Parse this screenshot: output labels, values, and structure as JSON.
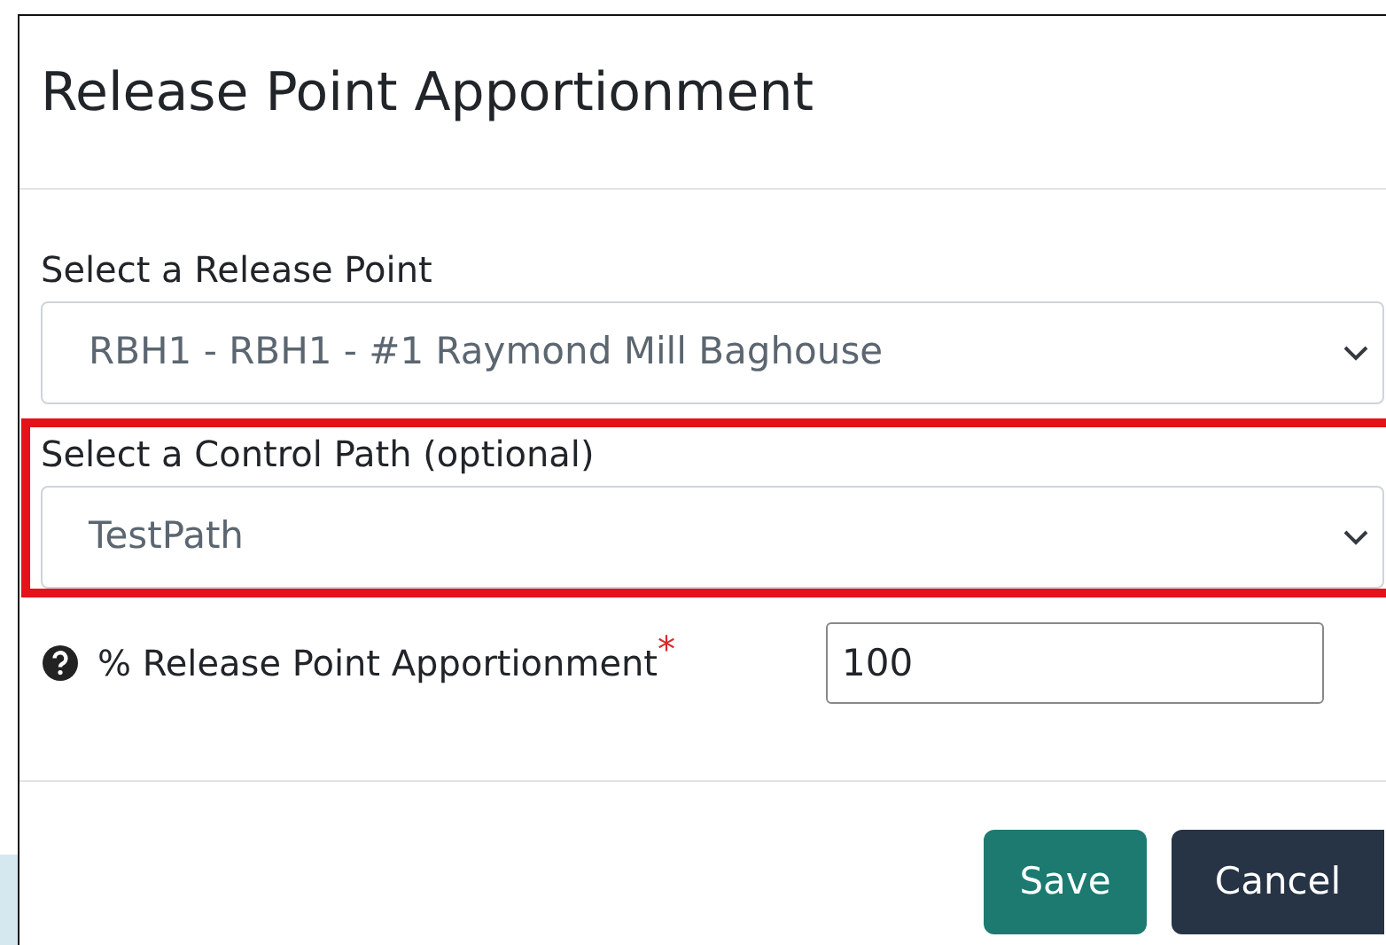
{
  "dialog": {
    "title": "Release Point Apportionment"
  },
  "fields": [
    {
      "kind": "select",
      "label": "Select a Release Point",
      "value": "RBH1 - RBH1 - #1 Raymond Mill Baghouse",
      "highlighted": false
    },
    {
      "kind": "select",
      "label": "Select a Control Path (optional)",
      "value": "TestPath",
      "highlighted": true
    },
    {
      "kind": "input",
      "label": "% Release Point Apportionment",
      "required_mark": "*",
      "value": "100",
      "highlighted": false
    }
  ],
  "buttons": [
    {
      "label": "Save",
      "kind": "primary"
    },
    {
      "label": "Cancel",
      "kind": "secondary"
    }
  ]
}
